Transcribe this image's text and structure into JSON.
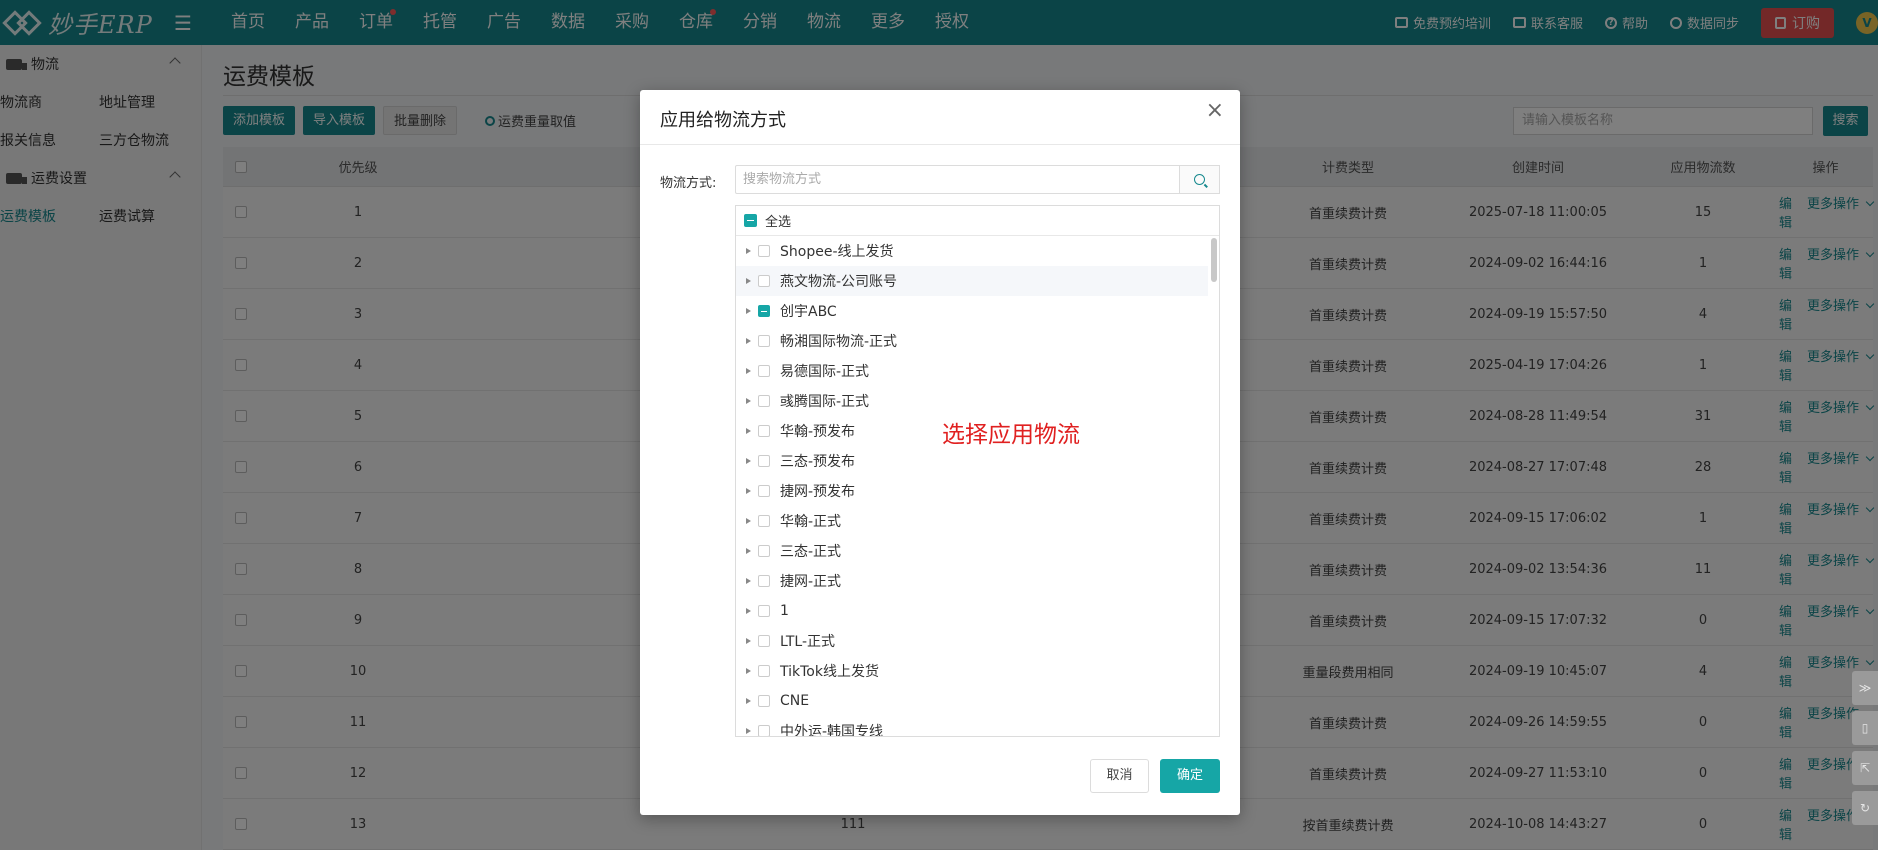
{
  "app": {
    "logo_text": "妙手ERP",
    "avatar_initial": "V"
  },
  "nav": [
    {
      "label": "首页",
      "dot": false
    },
    {
      "label": "产品",
      "dot": false
    },
    {
      "label": "订单",
      "dot": true
    },
    {
      "label": "托管",
      "dot": false
    },
    {
      "label": "广告",
      "dot": false
    },
    {
      "label": "数据",
      "dot": false
    },
    {
      "label": "采购",
      "dot": false
    },
    {
      "label": "仓库",
      "dot": true
    },
    {
      "label": "分销",
      "dot": false
    },
    {
      "label": "物流",
      "dot": false
    },
    {
      "label": "更多",
      "dot": false
    },
    {
      "label": "授权",
      "dot": false
    }
  ],
  "top_right": {
    "training": "免费预约培训",
    "support": "联系客服",
    "help": "帮助",
    "sync": "数据同步",
    "order": "订购"
  },
  "sidebar": {
    "group1": "物流",
    "row1": [
      "物流商",
      "地址管理"
    ],
    "row2": [
      "报关信息",
      "三方仓物流"
    ],
    "group2": "运费设置",
    "row3": [
      "运费模板",
      "运费试算"
    ]
  },
  "page": {
    "title": "运费模板",
    "add_btn": "添加模板",
    "import_btn": "导入模板",
    "batch_delete": "批量删除",
    "weight_link": "运费重量取值",
    "search_placeholder": "请输入模板名称",
    "search_btn": "搜索"
  },
  "table": {
    "headers": {
      "priority": "优先级",
      "type": "计费类型",
      "time": "创建时间",
      "count": "应用物流数",
      "op": "操作"
    },
    "edit_label": "编辑",
    "more_label": "更多操作",
    "rows": [
      {
        "priority": "1",
        "name": "",
        "type": "首重续费计费",
        "time": "2025-07-18 11:00:05",
        "count": "15"
      },
      {
        "priority": "2",
        "name": "",
        "type": "首重续费计费",
        "time": "2024-09-02 16:44:16",
        "count": "1"
      },
      {
        "priority": "3",
        "name": "",
        "type": "首重续费计费",
        "time": "2024-09-19 15:57:50",
        "count": "4"
      },
      {
        "priority": "4",
        "name": "",
        "type": "首重续费计费",
        "time": "2025-04-19 17:04:26",
        "count": "1"
      },
      {
        "priority": "5",
        "name": "",
        "type": "首重续费计费",
        "time": "2024-08-28 11:49:54",
        "count": "31"
      },
      {
        "priority": "6",
        "name": "",
        "type": "首重续费计费",
        "time": "2024-08-27 17:07:48",
        "count": "28"
      },
      {
        "priority": "7",
        "name": "",
        "type": "首重续费计费",
        "time": "2024-09-15 17:06:02",
        "count": "1"
      },
      {
        "priority": "8",
        "name": "",
        "type": "首重续费计费",
        "time": "2024-09-02 13:54:36",
        "count": "11"
      },
      {
        "priority": "9",
        "name": "",
        "type": "首重续费计费",
        "time": "2024-09-15 17:07:32",
        "count": "0"
      },
      {
        "priority": "10",
        "name": "",
        "type": "重量段费用相同",
        "time": "2024-09-19 10:45:07",
        "count": "4"
      },
      {
        "priority": "11",
        "name": "",
        "type": "首重续费计费",
        "time": "2024-09-26 14:59:55",
        "count": "0"
      },
      {
        "priority": "12",
        "name": "",
        "type": "首重续费计费",
        "time": "2024-09-27 11:53:10",
        "count": "0"
      },
      {
        "priority": "13",
        "name": "111",
        "type": "按首重续费计费",
        "time": "2024-10-08 14:43:27",
        "count": "0"
      }
    ]
  },
  "modal": {
    "title": "应用给物流方式",
    "field_label": "物流方式:",
    "search_placeholder": "搜索物流方式",
    "select_all": "全选",
    "annotation": "选择应用物流",
    "cancel": "取消",
    "confirm": "确定",
    "items": [
      {
        "label": "Shopee-线上发货",
        "checked": false,
        "highlight": false
      },
      {
        "label": "燕文物流-公司账号",
        "checked": false,
        "highlight": true
      },
      {
        "label": "创宇ABC",
        "checked": true,
        "highlight": false
      },
      {
        "label": "畅湘国际物流-正式",
        "checked": false,
        "highlight": false
      },
      {
        "label": "易德国际-正式",
        "checked": false,
        "highlight": false
      },
      {
        "label": "彧腾国际-正式",
        "checked": false,
        "highlight": false
      },
      {
        "label": "华翰-预发布",
        "checked": false,
        "highlight": false
      },
      {
        "label": "三态-预发布",
        "checked": false,
        "highlight": false
      },
      {
        "label": "捷网-预发布",
        "checked": false,
        "highlight": false
      },
      {
        "label": "华翰-正式",
        "checked": false,
        "highlight": false
      },
      {
        "label": "三态-正式",
        "checked": false,
        "highlight": false
      },
      {
        "label": "捷网-正式",
        "checked": false,
        "highlight": false
      },
      {
        "label": "1",
        "checked": false,
        "highlight": false
      },
      {
        "label": "LTL-正式",
        "checked": false,
        "highlight": false
      },
      {
        "label": "TikTok线上发货",
        "checked": false,
        "highlight": false
      },
      {
        "label": "CNE",
        "checked": false,
        "highlight": false
      },
      {
        "label": "中外运-韩国专线",
        "checked": false,
        "highlight": false
      }
    ]
  }
}
